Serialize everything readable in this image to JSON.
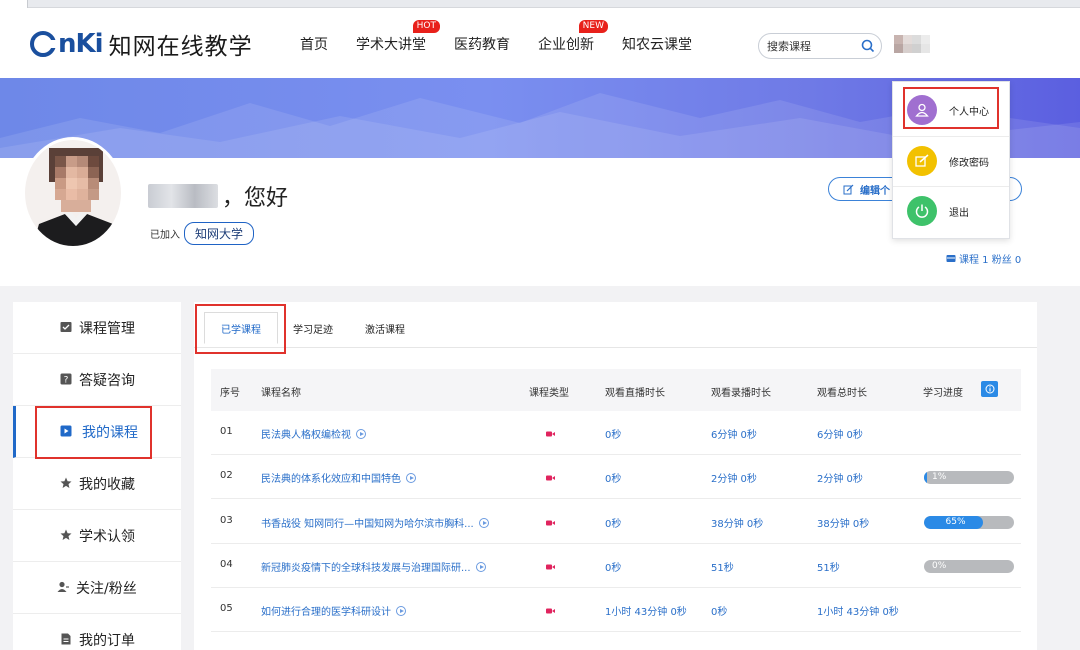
{
  "header": {
    "logo_mark": "CNKi",
    "logo_text": "知网在线教学",
    "nav": [
      {
        "label": "首页",
        "badge": ""
      },
      {
        "label": "学术大讲堂",
        "badge": "HOT"
      },
      {
        "label": "医药教育",
        "badge": ""
      },
      {
        "label": "企业创新",
        "badge": "NEW"
      },
      {
        "label": "知农云课堂",
        "badge": ""
      }
    ],
    "search_placeholder": "搜索课程"
  },
  "profile": {
    "greeting": "，您好",
    "joined_label": "已加入",
    "school": "知网大学",
    "edit_label": "编辑个",
    "stats": "课程 1 粉丝 0"
  },
  "dropdown": [
    {
      "label": "个人中心",
      "icon": "user-icon",
      "color": "#a06fd0"
    },
    {
      "label": "修改密码",
      "icon": "edit-icon",
      "color": "#f2c100"
    },
    {
      "label": "退出",
      "icon": "power-icon",
      "color": "#3ec26a"
    }
  ],
  "sidebar": [
    {
      "label": "课程管理",
      "icon": "course-manage-icon",
      "active": false
    },
    {
      "label": "答疑咨询",
      "icon": "question-icon",
      "active": false
    },
    {
      "label": "我的课程",
      "icon": "my-course-icon",
      "active": true
    },
    {
      "label": "我的收藏",
      "icon": "star-icon",
      "active": false
    },
    {
      "label": "学术认领",
      "icon": "star-icon",
      "active": false
    },
    {
      "label": "关注/粉丝",
      "icon": "follow-icon",
      "active": false
    },
    {
      "label": "我的订单",
      "icon": "order-icon",
      "active": false
    }
  ],
  "tabs": [
    "已学课程",
    "学习足迹",
    "激活课程"
  ],
  "table": {
    "headers": [
      "序号",
      "课程名称",
      "课程类型",
      "观看直播时长",
      "观看录播时长",
      "观看总时长",
      "学习进度"
    ],
    "rows": [
      {
        "no": "01",
        "name": "民法典人格权编检视",
        "live": "0秒",
        "record": "6分钟 0秒",
        "total": "6分钟 0秒",
        "progress": null,
        "progress_label": ""
      },
      {
        "no": "02",
        "name": "民法典的体系化效应和中国特色",
        "live": "0秒",
        "record": "2分钟 0秒",
        "total": "2分钟 0秒",
        "progress": 1,
        "progress_label": "1%"
      },
      {
        "no": "03",
        "name": "书香战役 知网同行—中国知网为哈尔滨市胸科...",
        "live": "0秒",
        "record": "38分钟 0秒",
        "total": "38分钟 0秒",
        "progress": 65,
        "progress_label": "65%"
      },
      {
        "no": "04",
        "name": "新冠肺炎疫情下的全球科技发展与治理国际研...",
        "live": "0秒",
        "record": "51秒",
        "total": "51秒",
        "progress": 0,
        "progress_label": "0%"
      },
      {
        "no": "05",
        "name": "如何进行合理的医学科研设计",
        "live": "1小时 43分钟 0秒",
        "record": "0秒",
        "total": "1小时 43分钟 0秒",
        "progress": null,
        "progress_label": ""
      }
    ]
  },
  "colors": {
    "accent": "#2069c8",
    "highlight": "#e0322c",
    "progress": "#2b8ae6"
  }
}
